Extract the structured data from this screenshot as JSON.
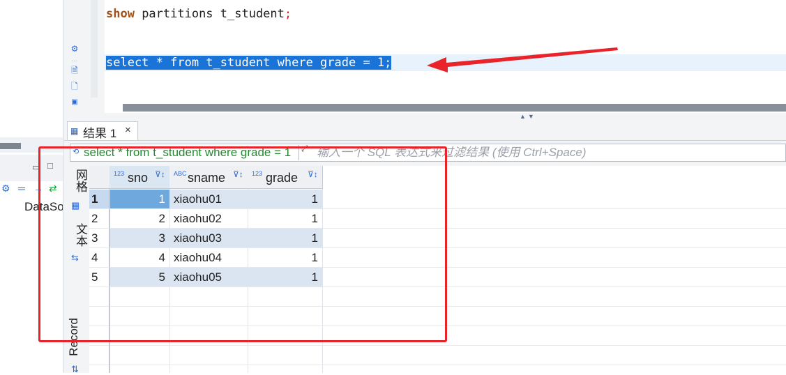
{
  "editor": {
    "line1": {
      "keyword": "show",
      "rest": " partitions t_student",
      "terminator": ";"
    },
    "line2": {
      "selected_text": "select * from t_student where grade = 1;"
    }
  },
  "navigator": {
    "datasource_label": "DataSo"
  },
  "results": {
    "tab_label": "结果 1",
    "tab_close": "×",
    "filter_sql": "select * from t_student where grade = 1",
    "filter_placeholder": "输入一个 SQL 表达式来过滤结果 (使用 Ctrl+Space)",
    "side_tabs": {
      "grid": "网格",
      "text": "文本",
      "record": "Record"
    },
    "columns": [
      {
        "type_badge": "123",
        "name": "sno"
      },
      {
        "type_badge": "ABC",
        "name": "sname"
      },
      {
        "type_badge": "123",
        "name": "grade"
      }
    ],
    "rows": [
      {
        "rownum": "1",
        "sno": "1",
        "sname": "xiaohu01",
        "grade": "1"
      },
      {
        "rownum": "2",
        "sno": "2",
        "sname": "xiaohu02",
        "grade": "1"
      },
      {
        "rownum": "3",
        "sno": "3",
        "sname": "xiaohu03",
        "grade": "1"
      },
      {
        "rownum": "4",
        "sno": "4",
        "sname": "xiaohu04",
        "grade": "1"
      },
      {
        "rownum": "5",
        "sno": "5",
        "sname": "xiaohu05",
        "grade": "1"
      }
    ]
  },
  "colors": {
    "selection": "#1a73d6",
    "annotation": "#e8232a",
    "keyword": "#a0521a",
    "filter_sql": "#248a2e",
    "selected_row": "#6fa8dc",
    "alt_row": "#dbe5f1"
  }
}
